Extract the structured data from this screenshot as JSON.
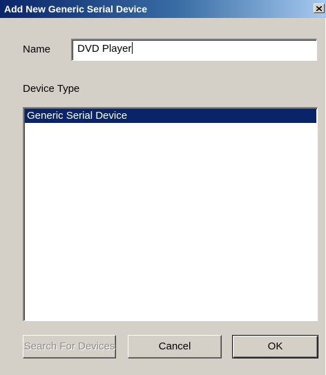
{
  "window": {
    "title": "Add New Generic Serial Device",
    "close_symbol": "×"
  },
  "name_field": {
    "label": "Name",
    "value": "DVD Player"
  },
  "device_type": {
    "label": "Device Type",
    "items": [
      {
        "label": "Generic Serial Device",
        "selected": true
      }
    ]
  },
  "buttons": {
    "search": "Search For Devices",
    "cancel": "Cancel",
    "ok": "OK"
  },
  "colors": {
    "titlebar_start": "#0a246a",
    "titlebar_end": "#a6caf0",
    "dialog_bg": "#d4d0c8",
    "selection_bg": "#0a246a"
  }
}
